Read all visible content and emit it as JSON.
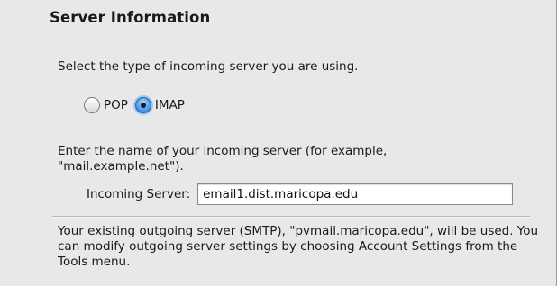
{
  "section": {
    "title": "Server Information"
  },
  "server_type": {
    "instruction": "Select the type of incoming server you are using.",
    "options": [
      {
        "label": "POP",
        "selected": false
      },
      {
        "label": "IMAP",
        "selected": true
      }
    ]
  },
  "incoming": {
    "description": "Enter the name of your incoming server (for example, \"mail.example.net\").",
    "label": "Incoming Server:",
    "value": "email1.dist.maricopa.edu"
  },
  "outgoing": {
    "note": "Your existing outgoing server (SMTP), \"pvmail.maricopa.edu\", will be used. You can modify outgoing server settings by choosing Account Settings from the Tools menu."
  },
  "colors": {
    "background": "#e8e8e8",
    "radio_selected": "#2f7ad6"
  }
}
